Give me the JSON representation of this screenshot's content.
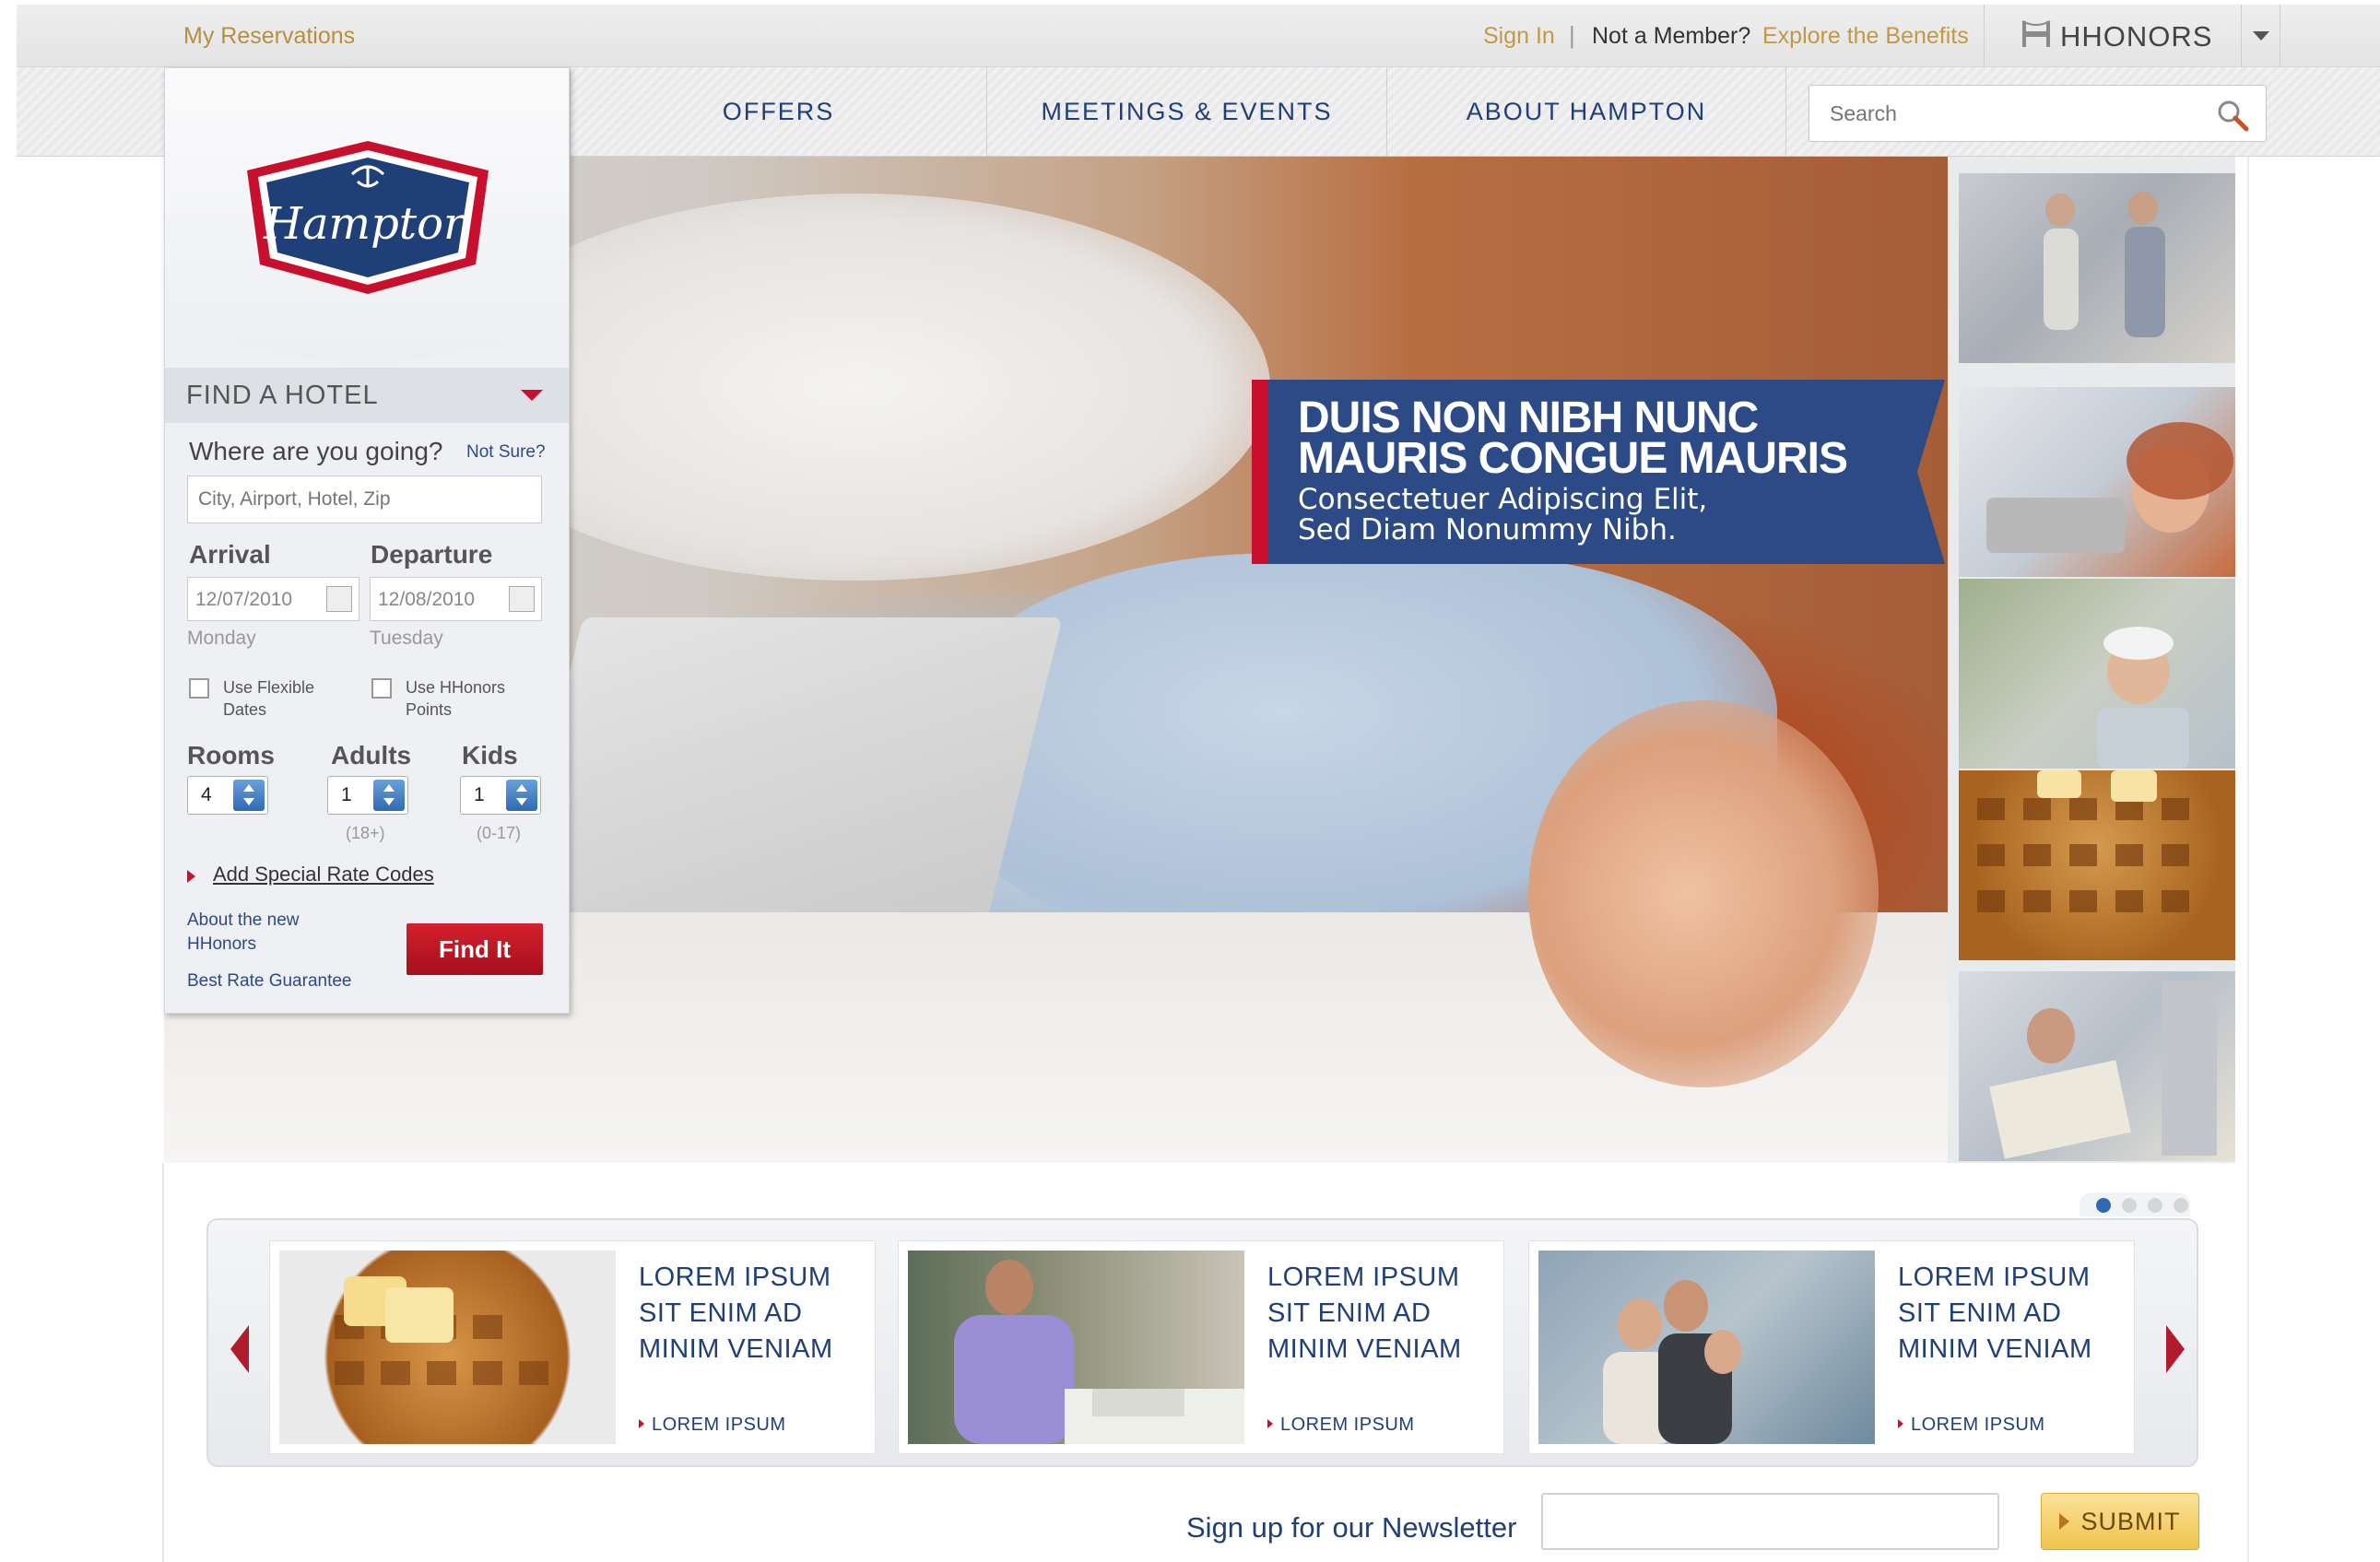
{
  "topbar": {
    "my_reservations": "My Reservations",
    "sign_in": "Sign In",
    "separator": "|",
    "not_member": "Not a Member?",
    "explore": "Explore the Benefits",
    "hhonors": "HHONORS"
  },
  "nav": {
    "items": [
      {
        "label": "OFFERS"
      },
      {
        "label": "MEETINGS & EVENTS"
      },
      {
        "label": "ABOUT HAMPTON"
      }
    ],
    "search_placeholder": "Search"
  },
  "logo": {
    "text": "Hampton"
  },
  "find_hotel": {
    "header": "FIND A HOTEL",
    "where_label": "Where are you going?",
    "not_sure": "Not Sure?",
    "destination_placeholder": "City, Airport, Hotel, Zip",
    "arrival_label": "Arrival",
    "departure_label": "Departure",
    "arrival_value": "12/07/2010",
    "departure_value": "12/08/2010",
    "arrival_day": "Monday",
    "departure_day": "Tuesday",
    "flexible_line1": "Use Flexible",
    "flexible_line2": "Dates",
    "hhonors_points_line1": "Use HHonors",
    "hhonors_points_line2": "Points",
    "rooms_label": "Rooms",
    "adults_label": "Adults",
    "kids_label": "Kids",
    "rooms_value": "4",
    "adults_value": "1",
    "kids_value": "1",
    "adults_hint": "(18+)",
    "kids_hint": "(0-17)",
    "special_rate": "Add Special Rate Codes",
    "about_line1": "About the new",
    "about_line2": "HHonors",
    "best_rate": "Best Rate Guarantee",
    "find_button": "Find It"
  },
  "hero": {
    "headline_line1": "DUIS NON NIBH NUNC",
    "headline_line2": "MAURIS CONGUE MAURIS",
    "sub_line1": "Consectetuer Adipiscing Elit,",
    "sub_line2": "Sed Diam Nonummy Nibh."
  },
  "carousel": {
    "active_dot": 1,
    "dot_count": 4,
    "cards": [
      {
        "title": "LOREM IPSUM SIT ENIM AD MINIM VENIAM",
        "link": "LOREM IPSUM"
      },
      {
        "title": "LOREM IPSUM SIT ENIM AD MINIM VENIAM",
        "link": "LOREM IPSUM"
      },
      {
        "title": "LOREM IPSUM SIT ENIM AD MINIM VENIAM",
        "link": "LOREM IPSUM"
      }
    ]
  },
  "newsletter": {
    "label": "Sign up for our Newsletter",
    "submit": "SUBMIT"
  },
  "colors": {
    "brand_navy": "#1f3f78",
    "brand_red": "#c8102e",
    "gold_link": "#c29a45"
  }
}
